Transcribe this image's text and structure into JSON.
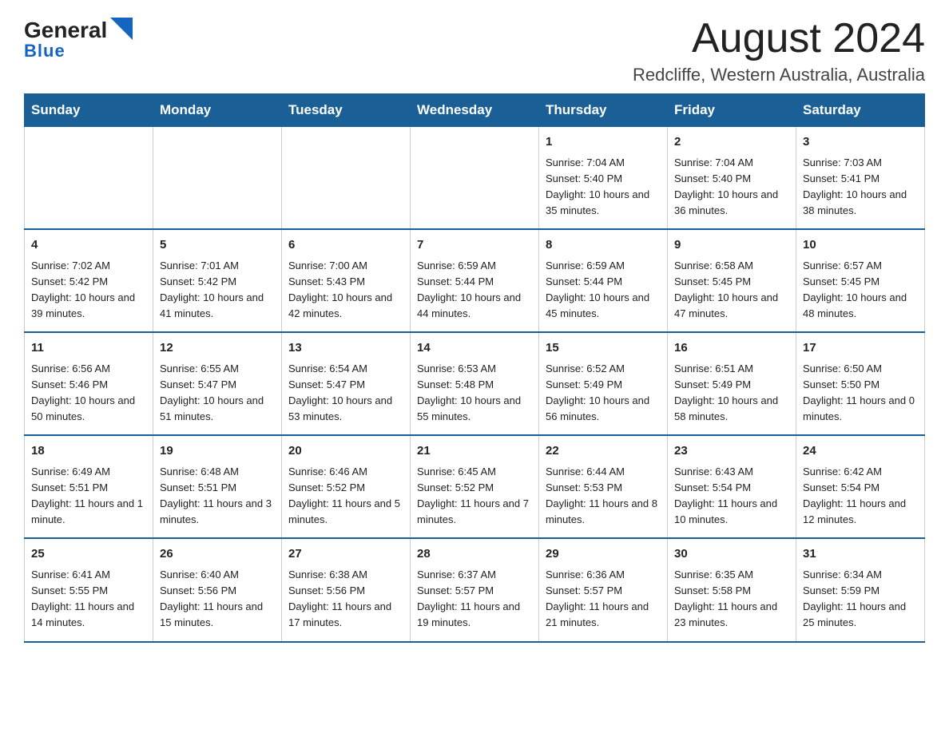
{
  "logo": {
    "general": "General",
    "blue": "Blue"
  },
  "header": {
    "month": "August 2024",
    "location": "Redcliffe, Western Australia, Australia"
  },
  "weekdays": [
    "Sunday",
    "Monday",
    "Tuesday",
    "Wednesday",
    "Thursday",
    "Friday",
    "Saturday"
  ],
  "weeks": [
    [
      {
        "num": "",
        "info": ""
      },
      {
        "num": "",
        "info": ""
      },
      {
        "num": "",
        "info": ""
      },
      {
        "num": "",
        "info": ""
      },
      {
        "num": "1",
        "info": "Sunrise: 7:04 AM\nSunset: 5:40 PM\nDaylight: 10 hours and 35 minutes."
      },
      {
        "num": "2",
        "info": "Sunrise: 7:04 AM\nSunset: 5:40 PM\nDaylight: 10 hours and 36 minutes."
      },
      {
        "num": "3",
        "info": "Sunrise: 7:03 AM\nSunset: 5:41 PM\nDaylight: 10 hours and 38 minutes."
      }
    ],
    [
      {
        "num": "4",
        "info": "Sunrise: 7:02 AM\nSunset: 5:42 PM\nDaylight: 10 hours and 39 minutes."
      },
      {
        "num": "5",
        "info": "Sunrise: 7:01 AM\nSunset: 5:42 PM\nDaylight: 10 hours and 41 minutes."
      },
      {
        "num": "6",
        "info": "Sunrise: 7:00 AM\nSunset: 5:43 PM\nDaylight: 10 hours and 42 minutes."
      },
      {
        "num": "7",
        "info": "Sunrise: 6:59 AM\nSunset: 5:44 PM\nDaylight: 10 hours and 44 minutes."
      },
      {
        "num": "8",
        "info": "Sunrise: 6:59 AM\nSunset: 5:44 PM\nDaylight: 10 hours and 45 minutes."
      },
      {
        "num": "9",
        "info": "Sunrise: 6:58 AM\nSunset: 5:45 PM\nDaylight: 10 hours and 47 minutes."
      },
      {
        "num": "10",
        "info": "Sunrise: 6:57 AM\nSunset: 5:45 PM\nDaylight: 10 hours and 48 minutes."
      }
    ],
    [
      {
        "num": "11",
        "info": "Sunrise: 6:56 AM\nSunset: 5:46 PM\nDaylight: 10 hours and 50 minutes."
      },
      {
        "num": "12",
        "info": "Sunrise: 6:55 AM\nSunset: 5:47 PM\nDaylight: 10 hours and 51 minutes."
      },
      {
        "num": "13",
        "info": "Sunrise: 6:54 AM\nSunset: 5:47 PM\nDaylight: 10 hours and 53 minutes."
      },
      {
        "num": "14",
        "info": "Sunrise: 6:53 AM\nSunset: 5:48 PM\nDaylight: 10 hours and 55 minutes."
      },
      {
        "num": "15",
        "info": "Sunrise: 6:52 AM\nSunset: 5:49 PM\nDaylight: 10 hours and 56 minutes."
      },
      {
        "num": "16",
        "info": "Sunrise: 6:51 AM\nSunset: 5:49 PM\nDaylight: 10 hours and 58 minutes."
      },
      {
        "num": "17",
        "info": "Sunrise: 6:50 AM\nSunset: 5:50 PM\nDaylight: 11 hours and 0 minutes."
      }
    ],
    [
      {
        "num": "18",
        "info": "Sunrise: 6:49 AM\nSunset: 5:51 PM\nDaylight: 11 hours and 1 minute."
      },
      {
        "num": "19",
        "info": "Sunrise: 6:48 AM\nSunset: 5:51 PM\nDaylight: 11 hours and 3 minutes."
      },
      {
        "num": "20",
        "info": "Sunrise: 6:46 AM\nSunset: 5:52 PM\nDaylight: 11 hours and 5 minutes."
      },
      {
        "num": "21",
        "info": "Sunrise: 6:45 AM\nSunset: 5:52 PM\nDaylight: 11 hours and 7 minutes."
      },
      {
        "num": "22",
        "info": "Sunrise: 6:44 AM\nSunset: 5:53 PM\nDaylight: 11 hours and 8 minutes."
      },
      {
        "num": "23",
        "info": "Sunrise: 6:43 AM\nSunset: 5:54 PM\nDaylight: 11 hours and 10 minutes."
      },
      {
        "num": "24",
        "info": "Sunrise: 6:42 AM\nSunset: 5:54 PM\nDaylight: 11 hours and 12 minutes."
      }
    ],
    [
      {
        "num": "25",
        "info": "Sunrise: 6:41 AM\nSunset: 5:55 PM\nDaylight: 11 hours and 14 minutes."
      },
      {
        "num": "26",
        "info": "Sunrise: 6:40 AM\nSunset: 5:56 PM\nDaylight: 11 hours and 15 minutes."
      },
      {
        "num": "27",
        "info": "Sunrise: 6:38 AM\nSunset: 5:56 PM\nDaylight: 11 hours and 17 minutes."
      },
      {
        "num": "28",
        "info": "Sunrise: 6:37 AM\nSunset: 5:57 PM\nDaylight: 11 hours and 19 minutes."
      },
      {
        "num": "29",
        "info": "Sunrise: 6:36 AM\nSunset: 5:57 PM\nDaylight: 11 hours and 21 minutes."
      },
      {
        "num": "30",
        "info": "Sunrise: 6:35 AM\nSunset: 5:58 PM\nDaylight: 11 hours and 23 minutes."
      },
      {
        "num": "31",
        "info": "Sunrise: 6:34 AM\nSunset: 5:59 PM\nDaylight: 11 hours and 25 minutes."
      }
    ]
  ]
}
